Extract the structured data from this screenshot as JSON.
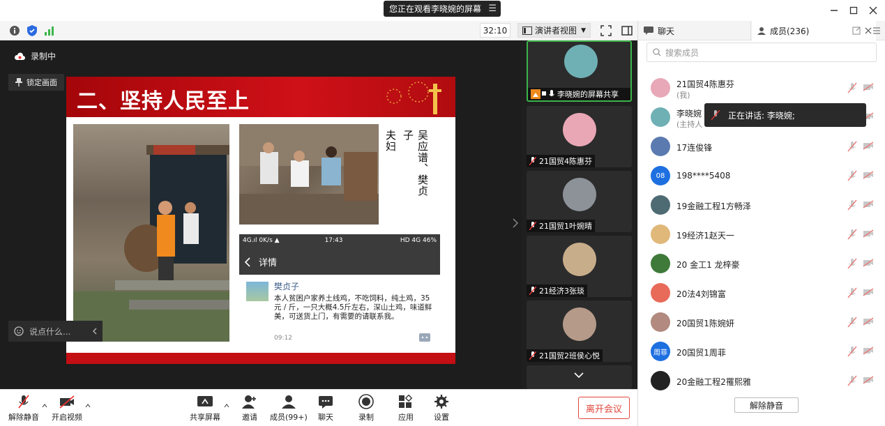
{
  "title_bar": {
    "share_banner": "您正在观看李晓婉的屏幕",
    "menu_icon": "menu-icon"
  },
  "toolbar": {
    "timer": "32:10",
    "view_selector": "演讲者视图"
  },
  "stage": {
    "recording": "录制中",
    "lock_view": "锁定画面",
    "chat_placeholder": "说点什么..."
  },
  "slide": {
    "title": "二、坚持人民至上",
    "vertical_caption": [
      "吴应谱、樊贞子",
      "夫妇"
    ],
    "phone": {
      "status_left": "4G.ıl  0K/s ▲",
      "status_time": "17:43",
      "status_right": "HD 4G 46%",
      "detail_label": "详情"
    },
    "post": {
      "name": "樊贞子",
      "body": "本人贫困户家养土线鸡，不吃饲料，纯土鸡，35元 / 斤，一只大概4.5斤左右，深山土鸡，味道鲜美，可送货上门，有需要的请联系我。",
      "time": "09:12"
    }
  },
  "thumbnails": [
    {
      "label": "李晓婉的屏幕共享",
      "color": "#6fb0b4"
    },
    {
      "label": "21国贸4陈惠芬",
      "color": "#e9a7b5"
    },
    {
      "label": "21国贸1叶婉晴",
      "color": "#8d9299"
    },
    {
      "label": "21经济3张琰",
      "color": "#c8ad8a"
    },
    {
      "label": "21国贸2班侯心悦",
      "color": "#b59a89"
    }
  ],
  "bottom_bar": {
    "unmute": "解除静音",
    "start_video": "开启视频",
    "share_screen": "共享屏幕",
    "invite": "邀请",
    "members": "成员(99+)",
    "chat": "聊天",
    "record": "录制",
    "apps": "应用",
    "settings": "设置",
    "leave": "离开会议"
  },
  "right_panel": {
    "tab_chat": "聊天",
    "tab_members": "成员(236)",
    "search_placeholder": "搜索成员",
    "speaking": "正在讲话: 李晓婉;",
    "unmute_all": "解除静音",
    "members": [
      {
        "name": "21国贸4陈惠芬",
        "sub": "(我)",
        "avatar_text": "",
        "color": "#e8a8b8"
      },
      {
        "name": "李晓婉",
        "sub": "(主持人",
        "avatar_text": "",
        "color": "#6fb0b4"
      },
      {
        "name": "17连俊锋",
        "sub": "",
        "avatar_text": "",
        "color": "#5a7ab0"
      },
      {
        "name": "198****5408",
        "sub": "",
        "avatar_text": "08",
        "color": "#1e6fe0"
      },
      {
        "name": "19金融工程1方畅泽",
        "sub": "",
        "avatar_text": "",
        "color": "#4e6b73"
      },
      {
        "name": "19经济1赵天一",
        "sub": "",
        "avatar_text": "",
        "color": "#e0b87a"
      },
      {
        "name": "20 金工1 龙梓豪",
        "sub": "",
        "avatar_text": "",
        "color": "#3f7a3a"
      },
      {
        "name": "20法4刘锦富",
        "sub": "",
        "avatar_text": "",
        "color": "#e86b5a"
      },
      {
        "name": "20国贸1陈婉妍",
        "sub": "",
        "avatar_text": "",
        "color": "#b28a80"
      },
      {
        "name": "20国贸1周菲",
        "sub": "",
        "avatar_text": "周菲",
        "color": "#1e6fe0"
      },
      {
        "name": "20金融工程2罹熙雅",
        "sub": "",
        "avatar_text": "",
        "color": "#222222"
      }
    ]
  }
}
